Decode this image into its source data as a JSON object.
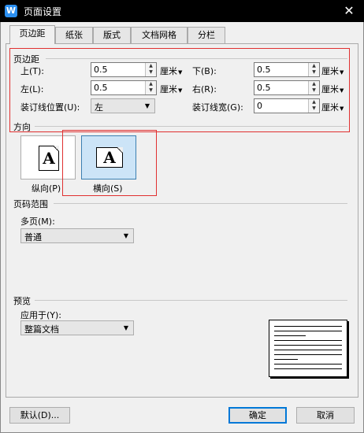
{
  "window": {
    "title": "页面设置",
    "app_icon": "W"
  },
  "tabs": [
    {
      "label": "页边距",
      "active": true
    },
    {
      "label": "纸张"
    },
    {
      "label": "版式"
    },
    {
      "label": "文档网格"
    },
    {
      "label": "分栏"
    }
  ],
  "margins": {
    "section": "页边距",
    "top": {
      "label": "上(T):",
      "value": "0.5",
      "unit": "厘米"
    },
    "bottom": {
      "label": "下(B):",
      "value": "0.5",
      "unit": "厘米"
    },
    "left": {
      "label": "左(L):",
      "value": "0.5",
      "unit": "厘米"
    },
    "right": {
      "label": "右(R):",
      "value": "0.5",
      "unit": "厘米"
    },
    "gutter_pos": {
      "label": "装订线位置(U):",
      "value": "左"
    },
    "gutter": {
      "label": "装订线宽(G):",
      "value": "0",
      "unit": "厘米"
    }
  },
  "orientation": {
    "section": "方向",
    "portrait": {
      "label": "纵向(P)",
      "glyph": "A"
    },
    "landscape": {
      "label": "横向(S)",
      "glyph": "A",
      "selected": true
    }
  },
  "pages": {
    "section": "页码范围",
    "multi_label": "多页(M):",
    "multi_value": "普通"
  },
  "preview": {
    "section": "预览",
    "apply_label": "应用于(Y):",
    "apply_value": "整篇文档"
  },
  "buttons": {
    "default": "默认(D)...",
    "ok": "确定",
    "cancel": "取消"
  },
  "colors": {
    "highlight_box": "#e03030",
    "selected_fill": "#cce4f7",
    "default_button_border": "#0078d7"
  }
}
